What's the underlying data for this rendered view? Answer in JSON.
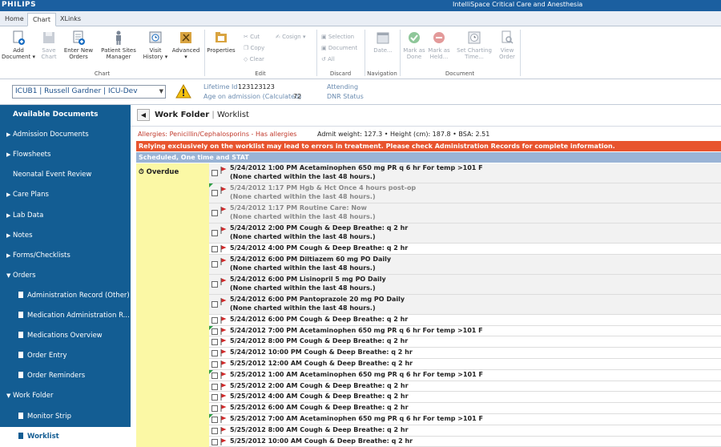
{
  "titlebar": {
    "brand": "PHILIPS",
    "product": "IntelliSpace Critical Care and Anesthesia"
  },
  "tabs": [
    "Home",
    "Chart",
    "XLinks"
  ],
  "ribbon": {
    "add_document": "Add Document ▾",
    "save_chart": "Save Chart",
    "enter_new_orders": "Enter New Orders",
    "patient_sites_manager": "Patient Sites Manager",
    "visit_history": "Visit History ▾",
    "advanced": "Advanced ▾",
    "properties": "Properties",
    "cut": "Cut",
    "copy": "Copy",
    "clear": "Clear",
    "cosign": "Cosign ▾",
    "selection": "Selection",
    "document": "Document",
    "all": "All",
    "date": "Date...",
    "mark_as_done": "Mark as Done",
    "mark_as_held": "Mark as Held...",
    "set_charting_time": "Set Charting Time...",
    "view_order": "View Order",
    "groups": {
      "chart": "Chart",
      "edit": "Edit",
      "discard": "Discard",
      "navigation": "Navigation",
      "document": "Document"
    }
  },
  "patient": {
    "selector": "ICUB1 | Russell Gardner | ICU-Dev",
    "lifetime_id_label": "Lifetime Id",
    "lifetime_id": "123123123",
    "age_label": "Age on admission (Calculated)",
    "age": "72",
    "attending_label": "Attending",
    "dnr_label": "DNR Status"
  },
  "sidebar": [
    {
      "label": "Available Documents",
      "kind": "header"
    },
    {
      "label": "Admission Documents",
      "kind": "collapsed"
    },
    {
      "label": "Flowsheets",
      "kind": "collapsed"
    },
    {
      "label": "Neonatal Event Review",
      "kind": "plain"
    },
    {
      "label": "Care Plans",
      "kind": "collapsed"
    },
    {
      "label": "Lab Data",
      "kind": "collapsed"
    },
    {
      "label": "Notes",
      "kind": "collapsed"
    },
    {
      "label": "Forms/Checklists",
      "kind": "collapsed"
    },
    {
      "label": "Orders",
      "kind": "expanded"
    },
    {
      "label": "Administration Record (Other)",
      "kind": "doc"
    },
    {
      "label": "Medication Administration R...",
      "kind": "doc"
    },
    {
      "label": "Medications Overview",
      "kind": "doc"
    },
    {
      "label": "Order Entry",
      "kind": "doc"
    },
    {
      "label": "Order Reminders",
      "kind": "doc"
    },
    {
      "label": "Work Folder",
      "kind": "expanded"
    },
    {
      "label": "Monitor Strip",
      "kind": "doc"
    },
    {
      "label": "Worklist",
      "kind": "doc-active"
    }
  ],
  "main": {
    "folder": "Work Folder",
    "view": "Worklist",
    "allergies": "Allergies: Penicillin/Cephalosporins - Has allergies",
    "measures": "Admit weight: 127.3  •  Height (cm): 187.8  •  BSA: 2.51",
    "alert": "Relying exclusively on the worklist may lead to errors in treatment. Please check Administration Records for complete information.",
    "section": "Scheduled, One time and STAT",
    "overdue": "Overdue",
    "rows": [
      {
        "l1": "5/24/2012 1:00 PM Acetaminophen 650 mg PR q 6 hr For temp >101 F",
        "l2": "(None charted within the last 48 hours.)",
        "muted": false,
        "corner": false
      },
      {
        "l1": "5/24/2012 1:17 PM Hgb & Hct Once 4 hours post-op",
        "l2": "(None charted within the last 48 hours.)",
        "muted": true,
        "corner": true
      },
      {
        "l1": "5/24/2012 1:17 PM Routine Care: Now",
        "l2": "(None charted within the last 48 hours.)",
        "muted": true,
        "corner": false
      },
      {
        "l1": "5/24/2012 2:00 PM Cough & Deep Breathe: q 2 hr",
        "l2": "(None charted within the last 48 hours.)",
        "muted": false,
        "corner": false
      },
      {
        "l1": "5/24/2012 4:00 PM Cough & Deep Breathe: q 2 hr",
        "l2": "",
        "muted": false,
        "corner": false
      },
      {
        "l1": "5/24/2012 6:00 PM Diltiazem 60 mg PO Daily",
        "l2": "(None charted within the last 48 hours.)",
        "muted": false,
        "corner": false
      },
      {
        "l1": "5/24/2012 6:00 PM Lisinopril 5 mg PO Daily",
        "l2": "(None charted within the last 48 hours.)",
        "muted": false,
        "corner": false
      },
      {
        "l1": "5/24/2012 6:00 PM Pantoprazole 20 mg PO Daily",
        "l2": "(None charted within the last 48 hours.)",
        "muted": false,
        "corner": false
      },
      {
        "l1": "5/24/2012 6:00 PM Cough & Deep Breathe: q 2 hr",
        "l2": "",
        "muted": false,
        "corner": false
      },
      {
        "l1": "5/24/2012 7:00 PM Acetaminophen 650 mg PR q 6 hr For temp >101 F",
        "l2": "",
        "muted": false,
        "corner": true
      },
      {
        "l1": "5/24/2012 8:00 PM Cough & Deep Breathe: q 2 hr",
        "l2": "",
        "muted": false,
        "corner": false
      },
      {
        "l1": "5/24/2012 10:00 PM Cough & Deep Breathe: q 2 hr",
        "l2": "",
        "muted": false,
        "corner": false
      },
      {
        "l1": "5/25/2012 12:00 AM Cough & Deep Breathe: q 2 hr",
        "l2": "",
        "muted": false,
        "corner": false
      },
      {
        "l1": "5/25/2012 1:00 AM Acetaminophen 650 mg PR q 6 hr For temp >101 F",
        "l2": "",
        "muted": false,
        "corner": true
      },
      {
        "l1": "5/25/2012 2:00 AM Cough & Deep Breathe: q 2 hr",
        "l2": "",
        "muted": false,
        "corner": false
      },
      {
        "l1": "5/25/2012 4:00 AM Cough & Deep Breathe: q 2 hr",
        "l2": "",
        "muted": false,
        "corner": false
      },
      {
        "l1": "5/25/2012 6:00 AM Cough & Deep Breathe: q 2 hr",
        "l2": "",
        "muted": false,
        "corner": false
      },
      {
        "l1": "5/25/2012 7:00 AM Acetaminophen 650 mg PR q 6 hr For temp >101 F",
        "l2": "",
        "muted": false,
        "corner": true
      },
      {
        "l1": "5/25/2012 8:00 AM Cough & Deep Breathe: q 2 hr",
        "l2": "",
        "muted": false,
        "corner": false
      },
      {
        "l1": "5/25/2012 10:00 AM Cough & Deep Breathe: q 2 hr",
        "l2": "",
        "muted": false,
        "corner": false
      }
    ]
  }
}
